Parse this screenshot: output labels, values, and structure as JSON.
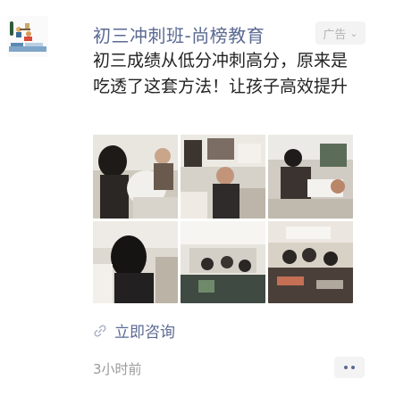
{
  "post": {
    "account_name": "初三冲刺班-尚榜教育",
    "ad_label": "广告",
    "ad_text": "初三成绩从低分冲刺高分，原来是吃透了这套方法！让孩子高效提升",
    "cta_label": "立即咨询",
    "timestamp": "3小时前"
  },
  "icons": {
    "ad_menu": "chevron-down-icon",
    "cta": "link-icon",
    "more": "more-dots-icon"
  },
  "colors": {
    "link": "#5b6a93",
    "text": "#222222",
    "meta": "#9a9a9a",
    "tag_bg": "#f3f3f3"
  }
}
